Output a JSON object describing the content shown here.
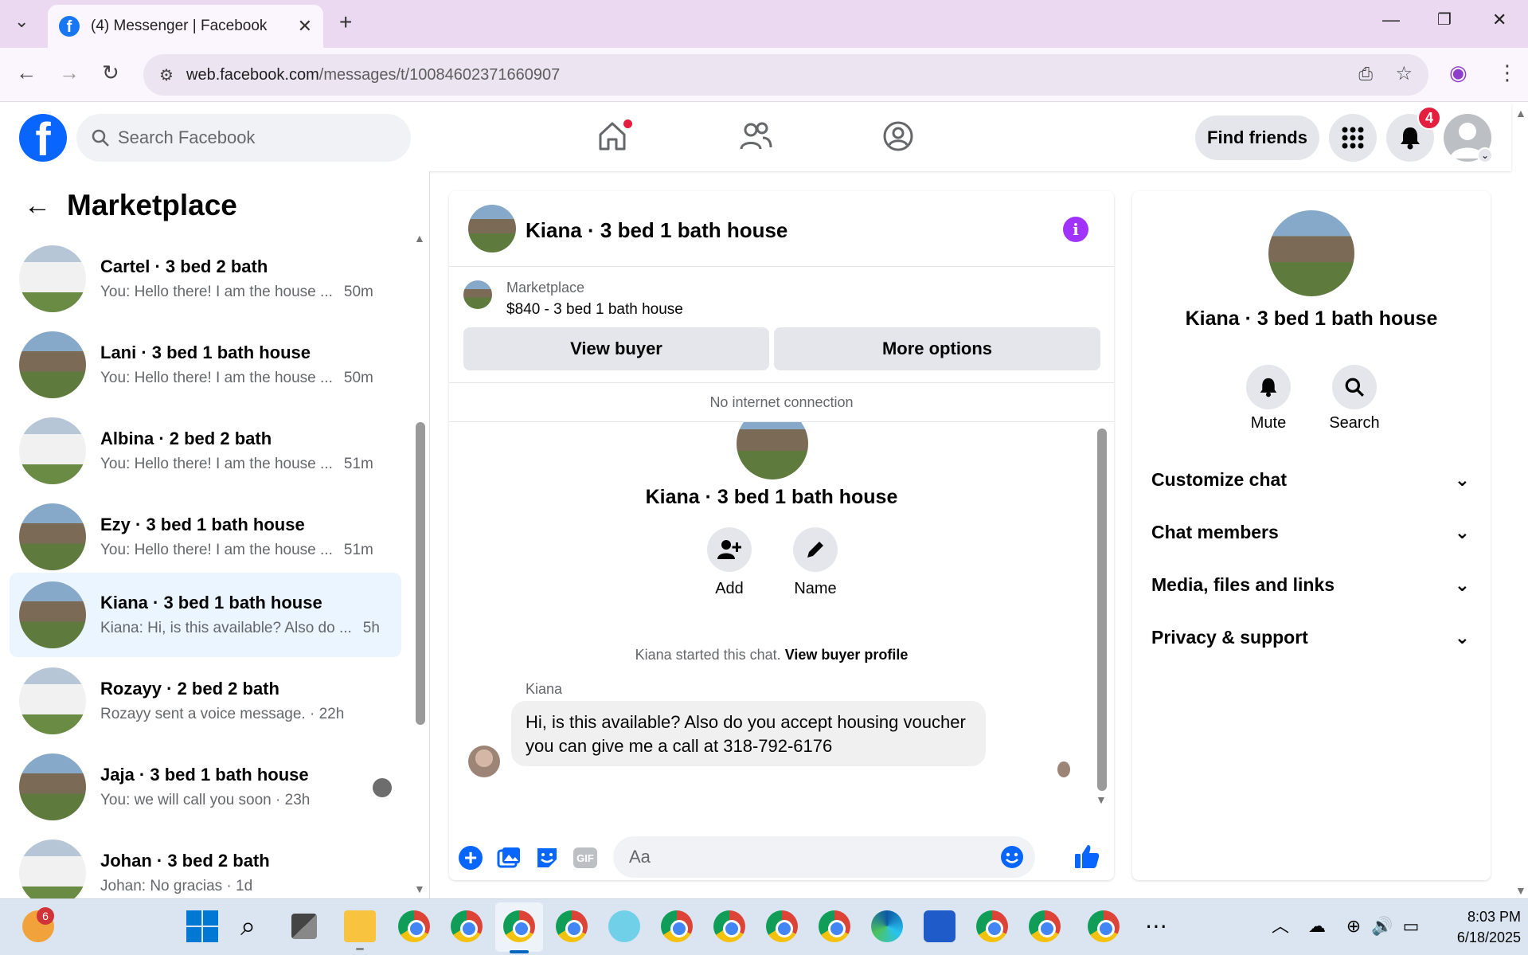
{
  "browser": {
    "tab_title": "(4) Messenger | Facebook",
    "url_host": "web.facebook.com",
    "url_path": "/messages/t/10084602371660907"
  },
  "fb": {
    "search_placeholder": "Search Facebook",
    "find_friends": "Find friends",
    "notif_count": "4"
  },
  "sidebar": {
    "title": "Marketplace",
    "conversations": [
      {
        "name": "Cartel · 3 bed 2 bath",
        "preview": "You: Hello there! I am the house ...",
        "time": "50m",
        "thumb": "white"
      },
      {
        "name": "Lani · 3 bed 1 bath house",
        "preview": "You: Hello there! I am the house ...",
        "time": "50m",
        "thumb": "brown"
      },
      {
        "name": "Albina · 2 bed 2 bath",
        "preview": "You: Hello there! I am the house ...",
        "time": "51m",
        "thumb": "white"
      },
      {
        "name": "Ezy · 3 bed 1 bath house",
        "preview": "You: Hello there! I am the house ...",
        "time": "51m",
        "thumb": "brown"
      },
      {
        "name": "Kiana · 3 bed 1 bath house",
        "preview": "Kiana: Hi, is this available? Also do ...",
        "time": "5h",
        "thumb": "brown"
      },
      {
        "name": "Rozayy · 2 bed 2 bath",
        "preview": "Rozayy sent a voice message. · 22h",
        "time": "",
        "thumb": "white"
      },
      {
        "name": "Jaja · 3 bed 1 bath house",
        "preview": "You: we will call you soon · 23h",
        "time": "",
        "thumb": "brown"
      },
      {
        "name": "Johan · 3 bed 2 bath",
        "preview": "Johan: No gracias · 1d",
        "time": "",
        "thumb": "white"
      }
    ]
  },
  "chat": {
    "header_name": "Kiana · 3 bed 1 bath house",
    "marketplace_label": "Marketplace",
    "listing": "$840 - 3 bed 1 bath house",
    "view_buyer": "View buyer",
    "more_options": "More options",
    "no_internet": "No internet connection",
    "intro_name": "Kiana · 3 bed 1 bath house",
    "add_label": "Add",
    "name_label": "Name",
    "started_text": "Kiana started this chat.",
    "view_buyer_profile": "View buyer profile",
    "sender": "Kiana",
    "message_line1": "Hi, is this available? Also do you accept housing voucher",
    "message_line2": "you can give me a call at 318-792-6176",
    "input_placeholder": "Aa"
  },
  "details": {
    "name": "Kiana · 3 bed 1 bath house",
    "mute": "Mute",
    "search": "Search",
    "sections": [
      "Customize chat",
      "Chat members",
      "Media, files and links",
      "Privacy & support"
    ]
  },
  "taskbar": {
    "notif_badge": "6",
    "time": "8:03 PM",
    "date": "6/18/2025"
  }
}
